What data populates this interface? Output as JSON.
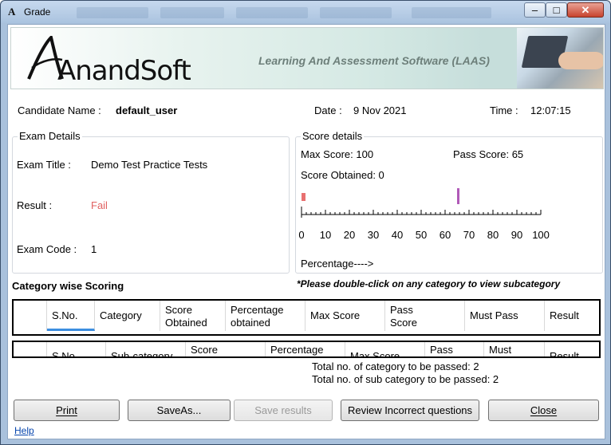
{
  "window": {
    "title": "Grade",
    "minimize": "–",
    "maximize": "□",
    "close": "✕"
  },
  "banner": {
    "logo": "AnandSoft",
    "tagline": "Learning And Assessment Software (LAAS)"
  },
  "header": {
    "candidate_label": "Candidate Name :",
    "candidate_value": "default_user",
    "date_label": "Date :",
    "date_value": "9 Nov 2021",
    "time_label": "Time :",
    "time_value": "12:07:15"
  },
  "exam_details": {
    "legend": "Exam Details",
    "title_label": "Exam Title :",
    "title_value": "Demo Test Practice Tests",
    "result_label": "Result :",
    "result_value": "Fail",
    "code_label": "Exam Code :",
    "code_value": "1"
  },
  "score_details": {
    "legend": "Score details",
    "max_score": "Max Score: 100",
    "pass_score": "Pass Score:  65",
    "score_obtained": "Score Obtained: 0",
    "percentage_label": "Percentage---->",
    "scale": [
      "0",
      "10",
      "20",
      "30",
      "40",
      "50",
      "60",
      "70",
      "80",
      "90",
      "100"
    ],
    "obtained_percent": 0,
    "pass_percent": 65,
    "obtained_color": "#e87070",
    "pass_color": "#b05ab8"
  },
  "category": {
    "heading": "Category wise Scoring",
    "note": "*Please double-click on any category to view  subcategory",
    "columns": [
      "S.No.",
      "Category",
      "Score Obtained",
      "Percentage obtained",
      "Max Score",
      "Pass Score",
      "Must Pass",
      "Result"
    ]
  },
  "subcategory": {
    "columns": [
      "S.No.",
      "Sub-category",
      "Score",
      "Percentage",
      "Max Score",
      "Pass",
      "Must",
      "Result"
    ]
  },
  "totals": {
    "category_passed": "Total no. of category to be passed: 2",
    "subcategory_passed": "Total no. of sub category to be passed: 2"
  },
  "buttons": {
    "print": "Print",
    "save_as": "SaveAs...",
    "save_results": "Save results",
    "review": "Review Incorrect questions",
    "close": "Close"
  },
  "help": "Help"
}
